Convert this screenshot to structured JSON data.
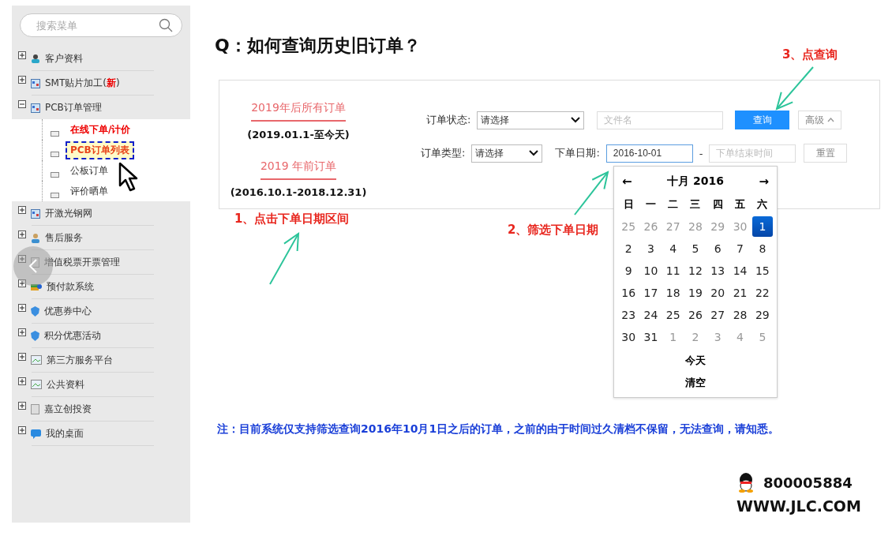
{
  "sidebar": {
    "search": {
      "placeholder": "搜索菜单"
    },
    "items": [
      {
        "label": "客户资料",
        "expanded": false
      },
      {
        "label": "SMT贴片加工(",
        "badge": "新",
        "label_end": ")",
        "expanded": false
      },
      {
        "label": "PCB订单管理",
        "expanded": true,
        "children": [
          {
            "label": "在线下单/计价",
            "kind": "promo",
            "selected": false
          },
          {
            "label": "PCB订单列表",
            "kind": "promo",
            "selected": true
          },
          {
            "label": "公板订单",
            "kind": "plain",
            "selected": false
          },
          {
            "label": "评价晒单",
            "kind": "plain",
            "selected": false
          }
        ]
      },
      {
        "label": "开激光钢网",
        "expanded": false
      },
      {
        "label": "售后服务",
        "expanded": false
      },
      {
        "label": "增值税票开票管理",
        "expanded": false
      },
      {
        "label": "预付款系统",
        "expanded": false
      },
      {
        "label": "优惠券中心",
        "expanded": false
      },
      {
        "label": "积分优惠活动",
        "expanded": false
      },
      {
        "label": "第三方服务平台",
        "expanded": false
      },
      {
        "label": "公共资料",
        "expanded": false
      },
      {
        "label": "嘉立创投资",
        "expanded": false
      },
      {
        "label": "我的桌面",
        "expanded": false
      }
    ]
  },
  "title": "Q：如何查询历史旧订单？",
  "panel": {
    "order_links": [
      {
        "label": "2019年后所有订单",
        "range": "(2019.01.1-至今天)"
      },
      {
        "label": "2019 年前订单",
        "range": "(2016.10.1-2018.12.31)"
      }
    ],
    "status_label": "订单状态:",
    "status_select": "请选择",
    "file_field": {
      "placeholder": "文件名"
    },
    "search_button": "查询",
    "advanced_button": "高级",
    "type_label": "订单类型:",
    "type_select": "请选择",
    "date_label": "下单日期:",
    "start_date": {
      "value": "2016-10-01",
      "focused": true
    },
    "date_separator": "-",
    "end_date": {
      "placeholder": "下单结束时间"
    },
    "reset_button": "重置"
  },
  "calendar": {
    "prev": "←",
    "month": "十月 2016",
    "next": "→",
    "weekdays": [
      "日",
      "一",
      "二",
      "三",
      "四",
      "五",
      "六"
    ],
    "days": [
      {
        "label": "25",
        "other_month": true,
        "selected": false
      },
      {
        "label": "26",
        "other_month": true,
        "selected": false
      },
      {
        "label": "27",
        "other_month": true,
        "selected": false
      },
      {
        "label": "28",
        "other_month": true,
        "selected": false
      },
      {
        "label": "29",
        "other_month": true,
        "selected": false
      },
      {
        "label": "30",
        "other_month": true,
        "selected": false
      },
      {
        "label": "1",
        "other_month": false,
        "selected": true
      },
      {
        "label": "2",
        "other_month": false,
        "selected": false
      },
      {
        "label": "3",
        "other_month": false,
        "selected": false
      },
      {
        "label": "4",
        "other_month": false,
        "selected": false
      },
      {
        "label": "5",
        "other_month": false,
        "selected": false
      },
      {
        "label": "6",
        "other_month": false,
        "selected": false
      },
      {
        "label": "7",
        "other_month": false,
        "selected": false
      },
      {
        "label": "8",
        "other_month": false,
        "selected": false
      },
      {
        "label": "9",
        "other_month": false,
        "selected": false
      },
      {
        "label": "10",
        "other_month": false,
        "selected": false
      },
      {
        "label": "11",
        "other_month": false,
        "selected": false
      },
      {
        "label": "12",
        "other_month": false,
        "selected": false
      },
      {
        "label": "13",
        "other_month": false,
        "selected": false
      },
      {
        "label": "14",
        "other_month": false,
        "selected": false
      },
      {
        "label": "15",
        "other_month": false,
        "selected": false
      },
      {
        "label": "16",
        "other_month": false,
        "selected": false
      },
      {
        "label": "17",
        "other_month": false,
        "selected": false
      },
      {
        "label": "18",
        "other_month": false,
        "selected": false
      },
      {
        "label": "19",
        "other_month": false,
        "selected": false
      },
      {
        "label": "20",
        "other_month": false,
        "selected": false
      },
      {
        "label": "21",
        "other_month": false,
        "selected": false
      },
      {
        "label": "22",
        "other_month": false,
        "selected": false
      },
      {
        "label": "23",
        "other_month": false,
        "selected": false
      },
      {
        "label": "24",
        "other_month": false,
        "selected": false
      },
      {
        "label": "25",
        "other_month": false,
        "selected": false
      },
      {
        "label": "26",
        "other_month": false,
        "selected": false
      },
      {
        "label": "27",
        "other_month": false,
        "selected": false
      },
      {
        "label": "28",
        "other_month": false,
        "selected": false
      },
      {
        "label": "29",
        "other_month": false,
        "selected": false
      },
      {
        "label": "30",
        "other_month": false,
        "selected": false
      },
      {
        "label": "31",
        "other_month": false,
        "selected": false
      },
      {
        "label": "1",
        "other_month": true,
        "selected": false
      },
      {
        "label": "2",
        "other_month": true,
        "selected": false
      },
      {
        "label": "3",
        "other_month": true,
        "selected": false
      },
      {
        "label": "4",
        "other_month": true,
        "selected": false
      },
      {
        "label": "5",
        "other_month": true,
        "selected": false
      }
    ],
    "today_button": "今天",
    "clear_button": "清空"
  },
  "steps": [
    "1、点击下单日期区间",
    "2、筛选下单日期",
    "3、点查询"
  ],
  "note": "注：目前系统仅支持筛选查询2016年10月1日之后的订单，之前的由于时间过久清档不保留，无法查询，请知悉。",
  "contact": {
    "qq": "800005884",
    "website": "WWW.JLC.COM"
  }
}
